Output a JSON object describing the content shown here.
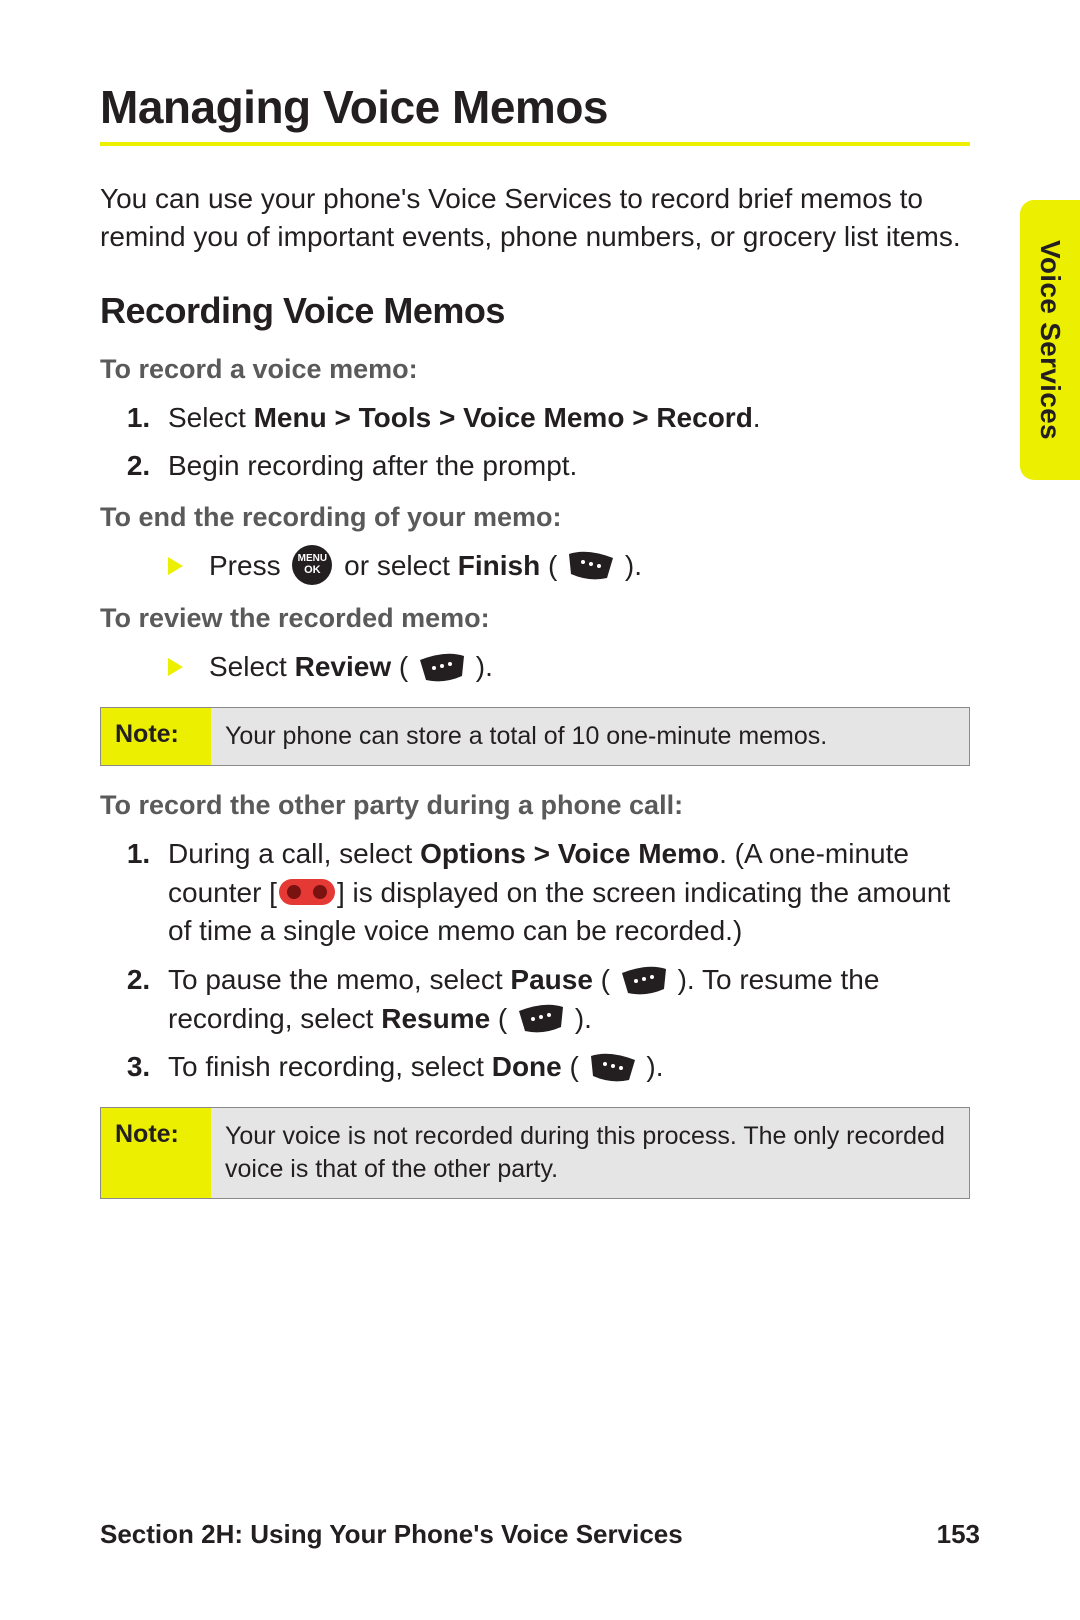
{
  "tab": {
    "label": "Voice Services"
  },
  "heading": "Managing Voice Memos",
  "intro": "You can use your phone's Voice Services to record brief memos to remind you of important events, phone numbers, or grocery list items.",
  "section": {
    "title": "Recording Voice Memos"
  },
  "task1": {
    "title": "To record a voice memo:",
    "step1_pre": "Select ",
    "step1_bold": "Menu > Tools > Voice Memo > Record",
    "step1_post": ".",
    "step2": "Begin recording after the prompt."
  },
  "task2": {
    "title": "To end the recording of your memo:",
    "pre": "Press ",
    "mid": " or select ",
    "bold": "Finish",
    "open": " (",
    "close": ")."
  },
  "task3": {
    "title": "To review the recorded memo:",
    "pre": "Select ",
    "bold": "Review",
    "open": " (",
    "close": ")."
  },
  "note1": {
    "label": "Note:",
    "text": "Your phone can store a total of 10 one-minute memos."
  },
  "task4": {
    "title": "To record the other party during a phone call:",
    "s1_pre": "During a call, select ",
    "s1_bold": "Options > Voice Memo",
    "s1_post1": ". (A one-minute counter [",
    "s1_post2": "] is displayed on the screen indicating the amount of time a single voice memo can be recorded.)",
    "s2_a": "To pause the memo, select ",
    "s2_bold1": "Pause",
    "s2_open": " (",
    "s2_close": "). ",
    "s2_b": "To resume the recording, select ",
    "s2_bold2": "Resume",
    "s2_open2": " (",
    "s2_close2": ").",
    "s3_a": "To finish recording, select ",
    "s3_bold": "Done",
    "s3_open": " (",
    "s3_close": ")."
  },
  "note2": {
    "label": "Note:",
    "text": "Your voice is not recorded during this process. The only recorded voice is that of the other party."
  },
  "footer": {
    "section": "Section 2H: Using Your Phone's Voice Services",
    "page": "153"
  },
  "icons": {
    "menuok_top": "MENU",
    "menuok_bottom": "OK"
  }
}
